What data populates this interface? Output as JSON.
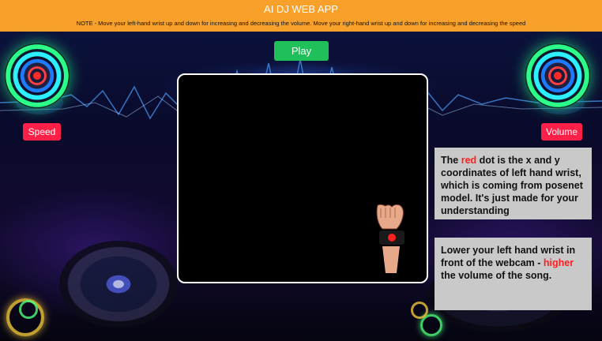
{
  "header": {
    "title": "AI DJ WEB APP",
    "note": "NOTE - Move your left-hand wrist up and down for increasing and decreasing the volume. Move your right-hand wrist up and down for increasing and decreasing the speed"
  },
  "controls": {
    "play_label": "Play",
    "speed_label": "Speed",
    "volume_label": "Volume"
  },
  "info_red_dot": {
    "part1": "The ",
    "highlight": "red",
    "part2": " dot is the x and y coordinates of left hand wrist, which is coming from posenet model. It's just made for your understanding"
  },
  "info_volume": {
    "part1": "Lower your left hand wrist in front of the webcam - ",
    "highlight": "higher",
    "part2": " the volume of the song."
  },
  "colors": {
    "header_bg": "#f7a12a",
    "play_button": "#1fbf5a",
    "label_buttons": "#ff1f47",
    "highlight_text": "#ff1f1f",
    "info_box_bg": "#c9c9c9"
  },
  "icons": {
    "left_turntable": "speaker-knob-icon",
    "right_turntable": "speaker-knob-icon",
    "wrist_marker": "wrist-hand-icon"
  }
}
